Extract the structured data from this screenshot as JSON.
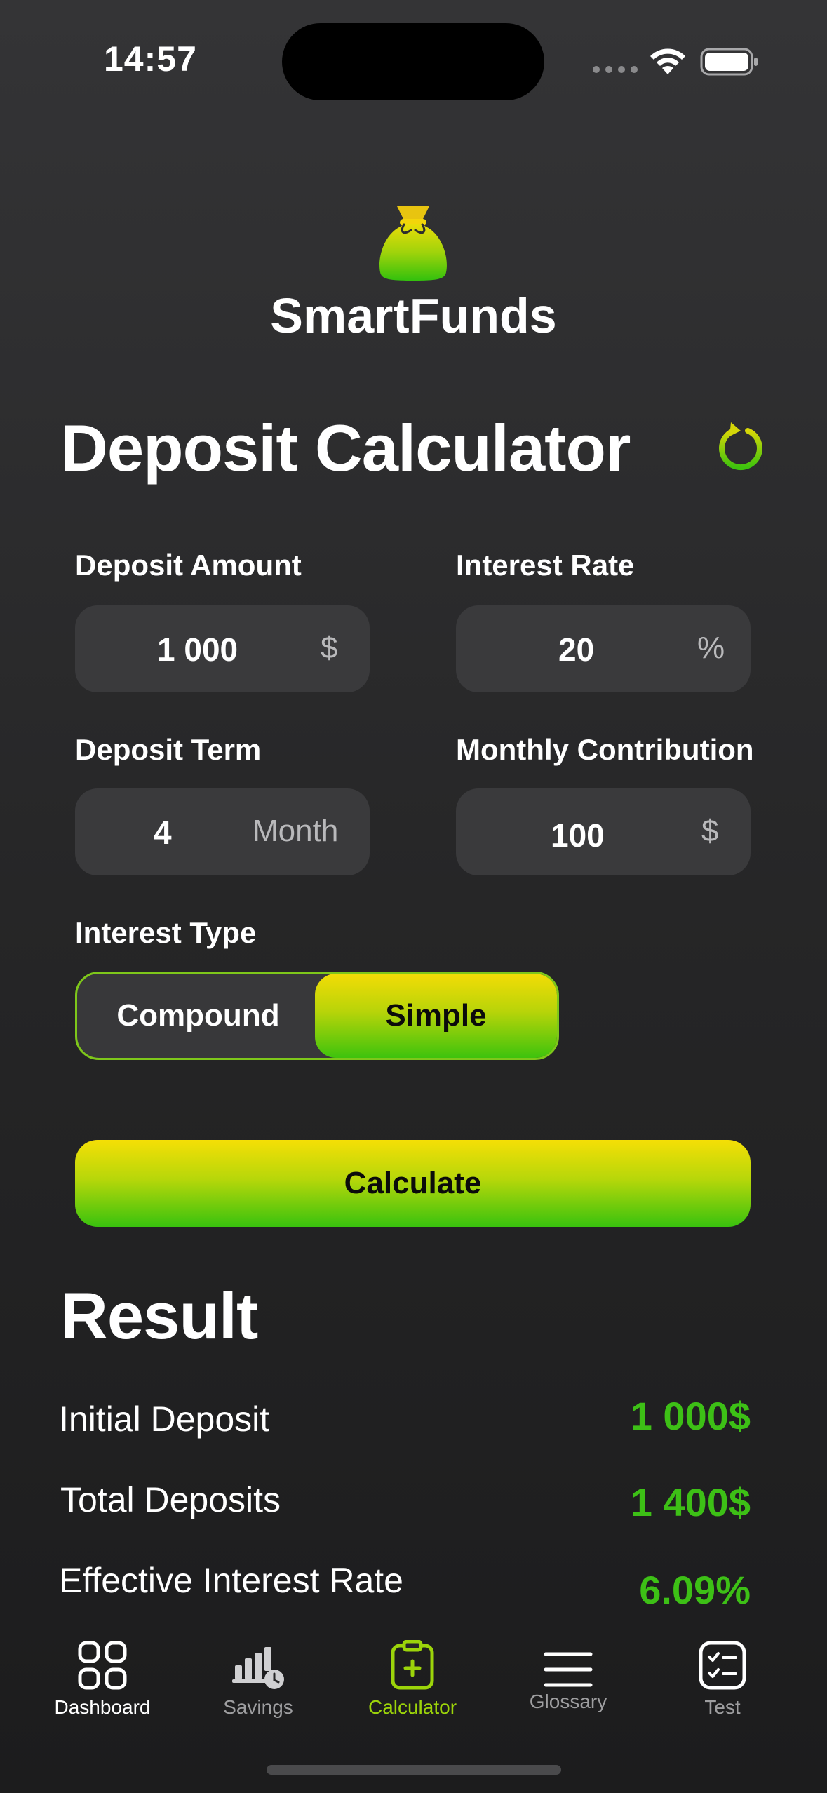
{
  "status_bar": {
    "time": "14:57"
  },
  "app": {
    "name": "SmartFunds"
  },
  "page": {
    "title": "Deposit Calculator"
  },
  "form": {
    "deposit_amount": {
      "label": "Deposit Amount",
      "value": "1 000",
      "unit": "$"
    },
    "interest_rate": {
      "label": "Interest Rate",
      "value": "20",
      "unit": "%"
    },
    "deposit_term": {
      "label": "Deposit Term",
      "value": "4",
      "unit": "Month"
    },
    "monthly_contribution": {
      "label": "Monthly Contribution",
      "value": "100",
      "unit": "$"
    },
    "interest_type": {
      "label": "Interest Type",
      "options": [
        "Compound",
        "Simple"
      ],
      "selected": "Simple"
    },
    "calculate_label": "Calculate"
  },
  "result": {
    "title": "Result",
    "rows": [
      {
        "label": "Initial Deposit",
        "value": "1 000$"
      },
      {
        "label": "Total Deposits",
        "value": "1 400$"
      },
      {
        "label": "Effective Interest Rate",
        "value": "6.09%"
      }
    ]
  },
  "tab_bar": {
    "active": "Calculator",
    "tabs": [
      {
        "label": "Dashboard",
        "icon": "grid-icon"
      },
      {
        "label": "Savings",
        "icon": "bar-chart-clock-icon"
      },
      {
        "label": "Calculator",
        "icon": "clipboard-plus-icon"
      },
      {
        "label": "Glossary",
        "icon": "menu-lines-icon"
      },
      {
        "label": "Test",
        "icon": "checklist-icon"
      }
    ]
  },
  "colors": {
    "accent_green": "#3dc016",
    "accent_yellow": "#f3dc06",
    "background": "#262627",
    "input_bg": "#3a3a3c",
    "tab_inactive": "#9e9ea0"
  }
}
